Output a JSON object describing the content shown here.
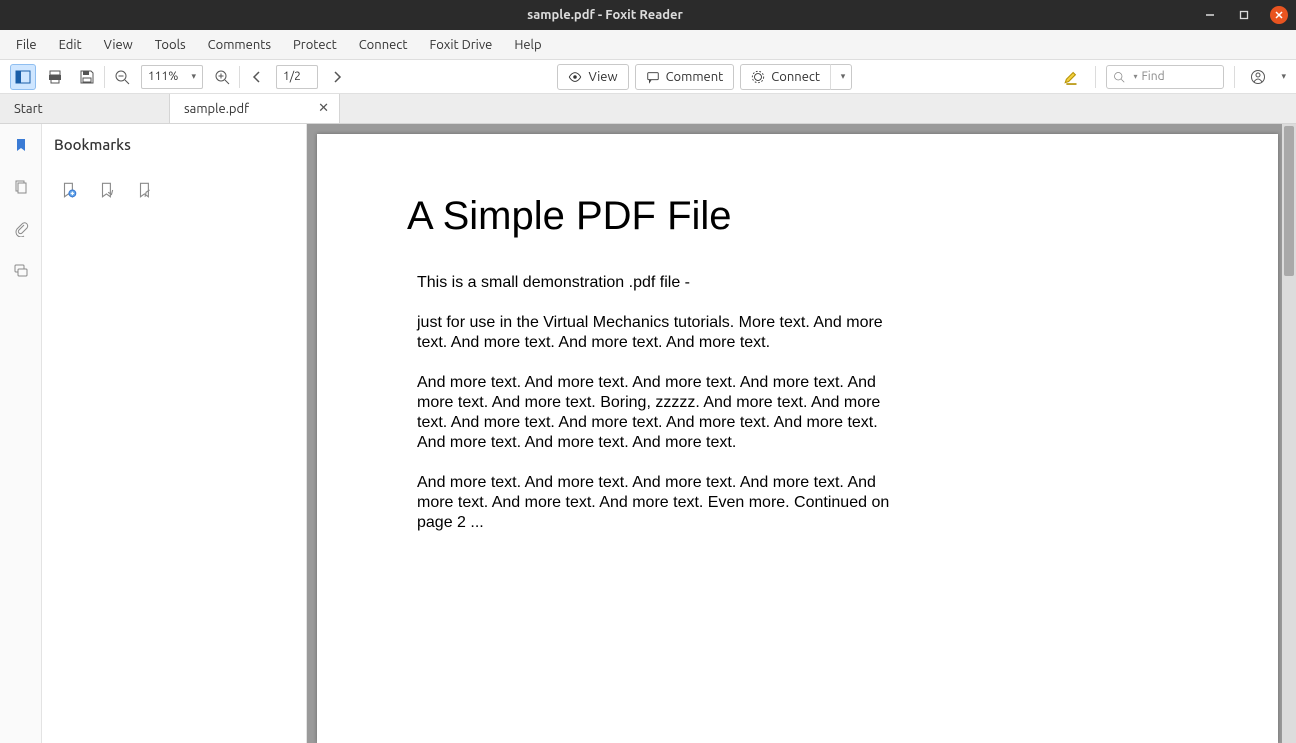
{
  "window": {
    "title": "sample.pdf - Foxit Reader"
  },
  "menu": {
    "items": [
      "File",
      "Edit",
      "View",
      "Tools",
      "Comments",
      "Protect",
      "Connect",
      "Foxit Drive",
      "Help"
    ]
  },
  "toolbar": {
    "zoom": "111%",
    "page_display": "1/2",
    "view_label": "View",
    "comment_label": "Comment",
    "connect_label": "Connect",
    "find_placeholder": "Find"
  },
  "tabs": {
    "start_label": "Start",
    "doc_label": "sample.pdf"
  },
  "sidebar": {
    "panel_title": "Bookmarks"
  },
  "document": {
    "heading": "A Simple PDF File",
    "p1": "This is a small demonstration .pdf file -",
    "p2": "just for use in the Virtual Mechanics tutorials. More text. And more text. And more text. And more text. And more text.",
    "p3": "And more text. And more text. And more text. And more text. And more text. And more text. Boring, zzzzz. And more text. And more text. And more text. And more text. And more text. And more text. And more text. And more text. And more text.",
    "p4": "And more text. And more text. And more text. And more text. And more text. And more text. And more text. Even more. Continued on page 2 ..."
  }
}
